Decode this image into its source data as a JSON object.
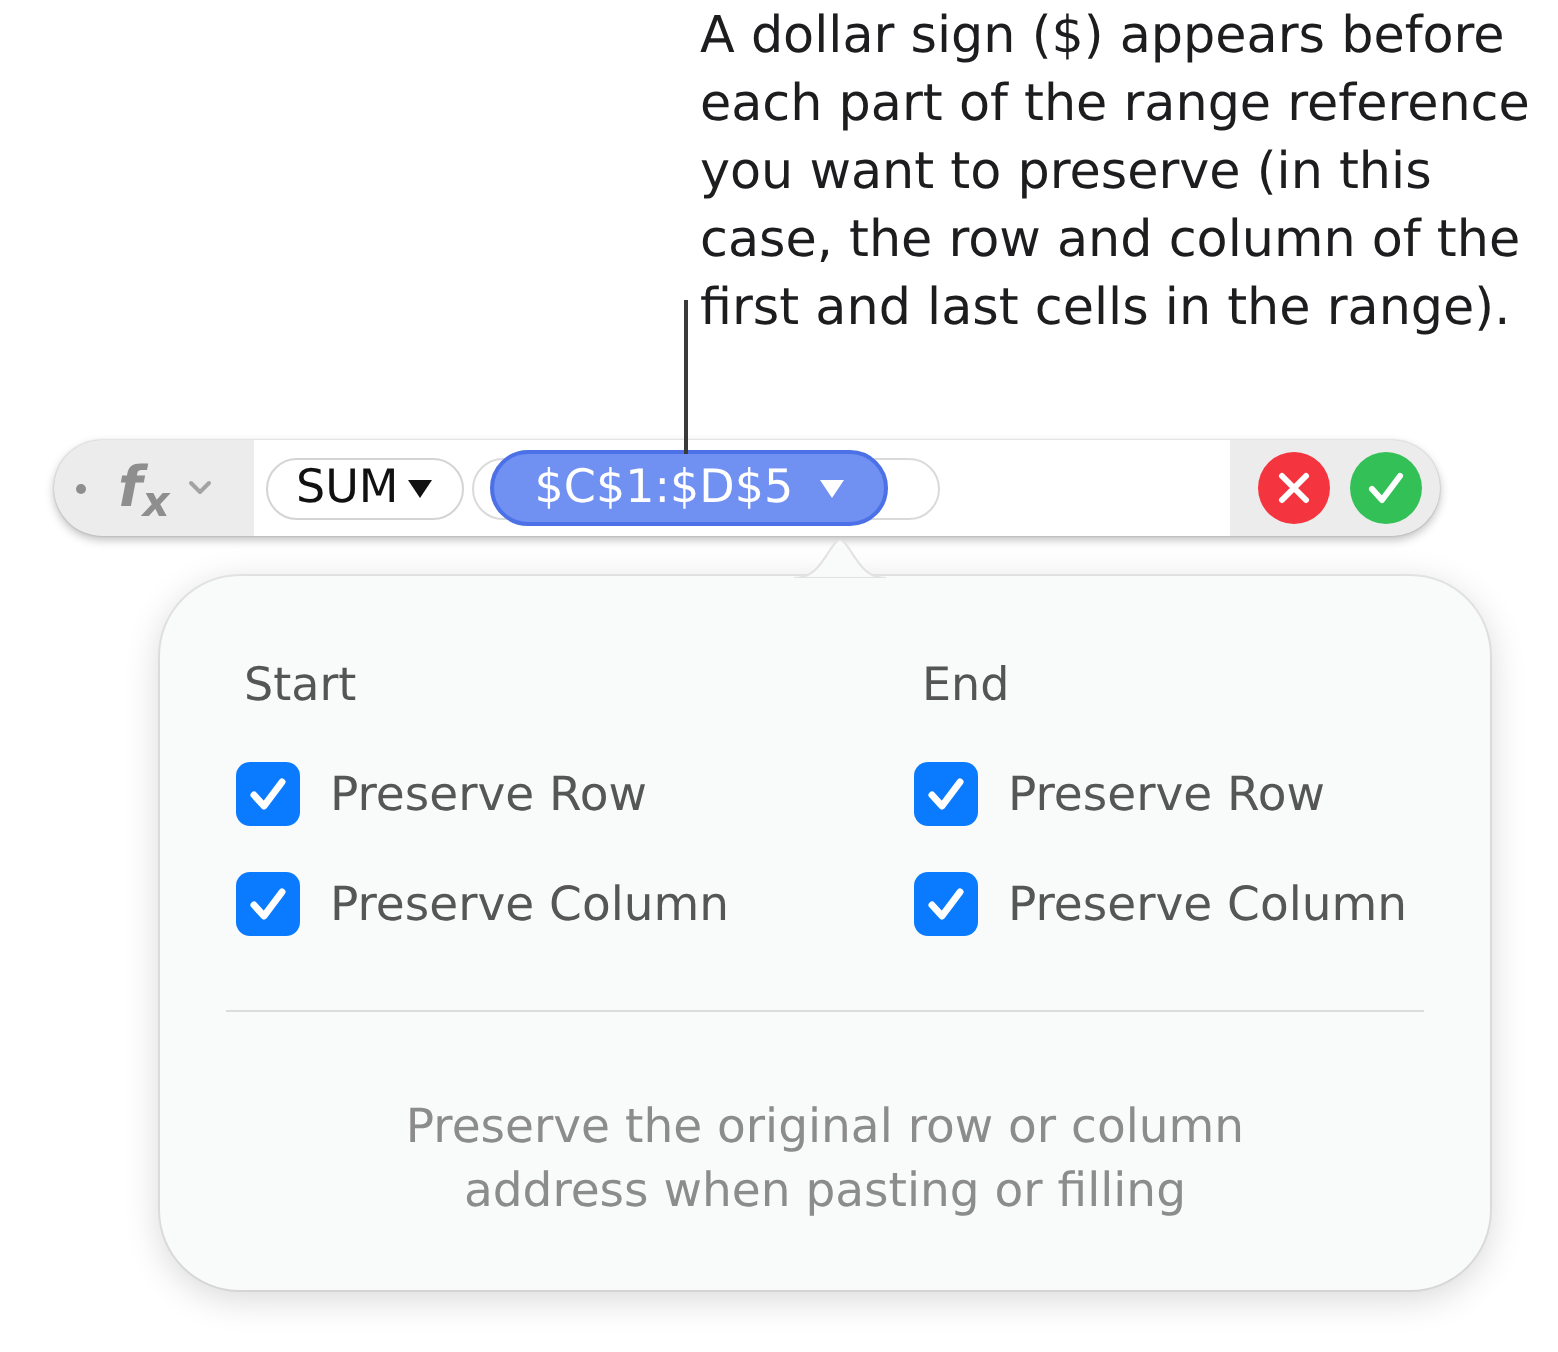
{
  "callout": {
    "text": "A dollar sign ($) appears before\neach part of the range reference\nyou want to preserve (in this\ncase, the row and column of the\nfirst and last cells in the range)."
  },
  "formula_bar": {
    "function_button": {
      "label": "f$_{x}$"
    },
    "tokens": [
      {
        "kind": "function",
        "text": "SUM",
        "selected": false
      },
      {
        "kind": "range",
        "text": "$C$1:$D$5",
        "selected": true
      }
    ],
    "buttons": [
      {
        "kind": "cancel"
      },
      {
        "kind": "accept"
      }
    ]
  },
  "popover": {
    "groups": [
      {
        "title": "Start",
        "options": [
          {
            "label": "Preserve Row",
            "checked": true
          },
          {
            "label": "Preserve Column",
            "checked": true
          }
        ]
      },
      {
        "title": "End",
        "options": [
          {
            "label": "Preserve Row",
            "checked": true
          },
          {
            "label": "Preserve Column",
            "checked": true
          }
        ]
      }
    ],
    "footer": "Preserve the original row or column\naddress when pasting or filling"
  }
}
